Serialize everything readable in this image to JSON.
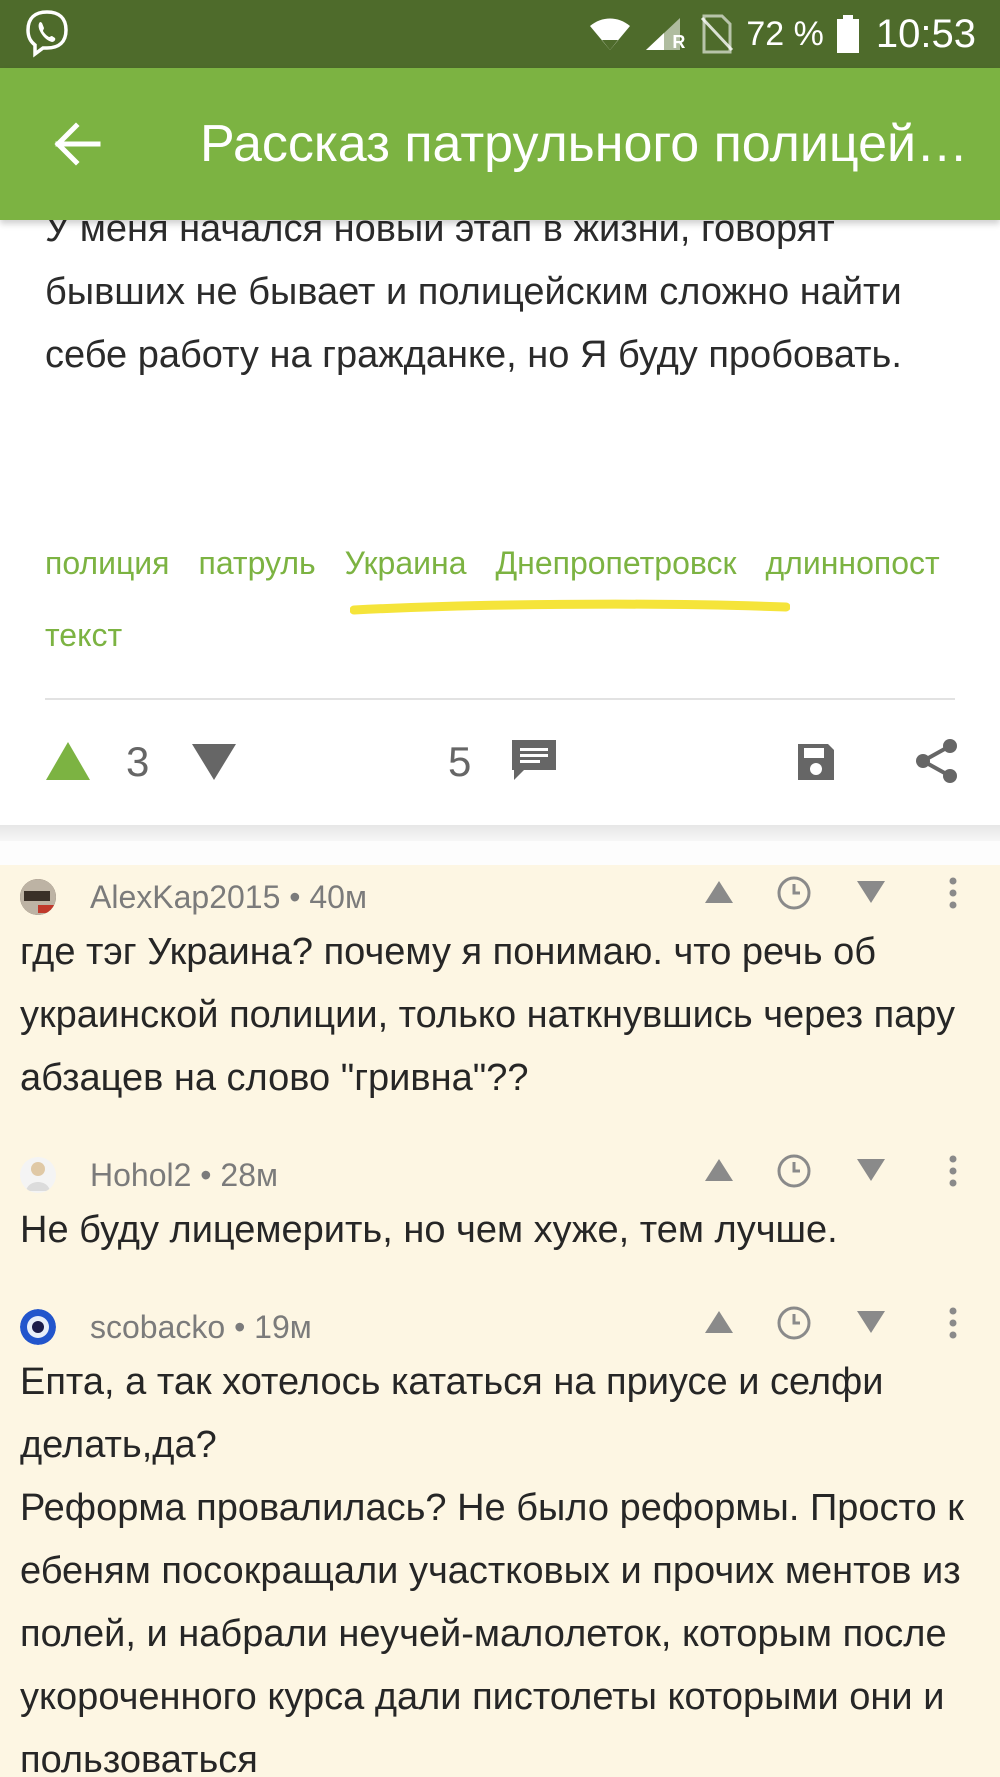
{
  "status_bar": {
    "battery": "72 %",
    "time": "10:53",
    "roaming_indicator": "R"
  },
  "appbar": {
    "title": "Рассказ патрульного полицейского"
  },
  "post": {
    "text": "У меня начался новый этап в жизни, говорят бывших не бывает и полицейским сложно найти себе работу на гражданке, но Я буду пробовать.",
    "tags": [
      "полиция",
      "патруль",
      "Украина",
      "Днепропетровск",
      "длиннопост",
      "текст"
    ],
    "rating": "3",
    "comments_count": "5"
  },
  "colors": {
    "status_bar": "#4e6b2b",
    "appbar": "#7cb342",
    "accent": "#7cb342",
    "comments_bg": "#fdf6e3",
    "highlight": "#f5e43a"
  },
  "comments": [
    {
      "author": "AlexKap2015",
      "time": "40м",
      "text": [
        "где тэг Украина? почему я понимаю. что речь об украинской полиции, только наткнувшись через пару абзацев на слово \"гривна\"??"
      ]
    },
    {
      "author": "Hohol2",
      "time": "28м",
      "text": [
        "Не буду лицемерить, но чем хуже, тем лучше."
      ]
    },
    {
      "author": "scobacko",
      "time": "19м",
      "text": [
        "Епта, а так хотелось кататься на приусе и селфи делать,да?",
        "Реформа провалилась? Не было реформы. Просто к ебеням посокращали участковых и прочих ментов из полей, и набрали неучей-малолеток, которым после укороченного курса дали пистолеты которыми они и пользоваться"
      ]
    }
  ]
}
